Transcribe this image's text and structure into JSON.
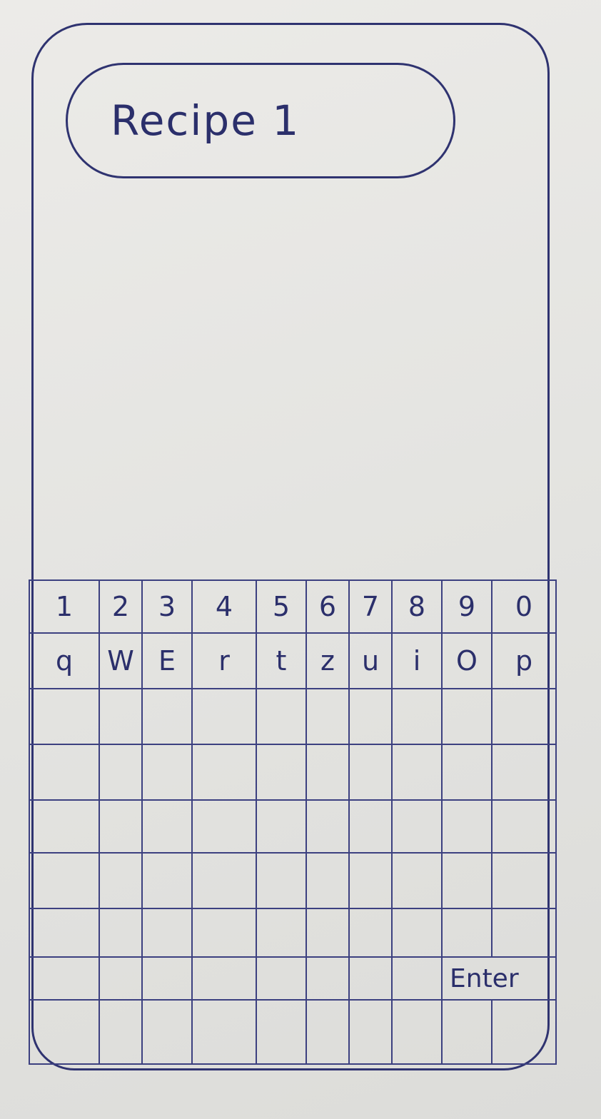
{
  "title": "Recipe 1",
  "keyboard": {
    "row_numbers": [
      "1",
      "2",
      "3",
      "4",
      "5",
      "6",
      "7",
      "8",
      "9",
      "0"
    ],
    "row_letters": [
      "q",
      "W",
      "E",
      "r",
      "t",
      "z",
      "u",
      "i",
      "O",
      "p"
    ],
    "enter_label": "Enter"
  },
  "colors": {
    "ink": "#2f3370",
    "paper": "#e6e6e3"
  }
}
